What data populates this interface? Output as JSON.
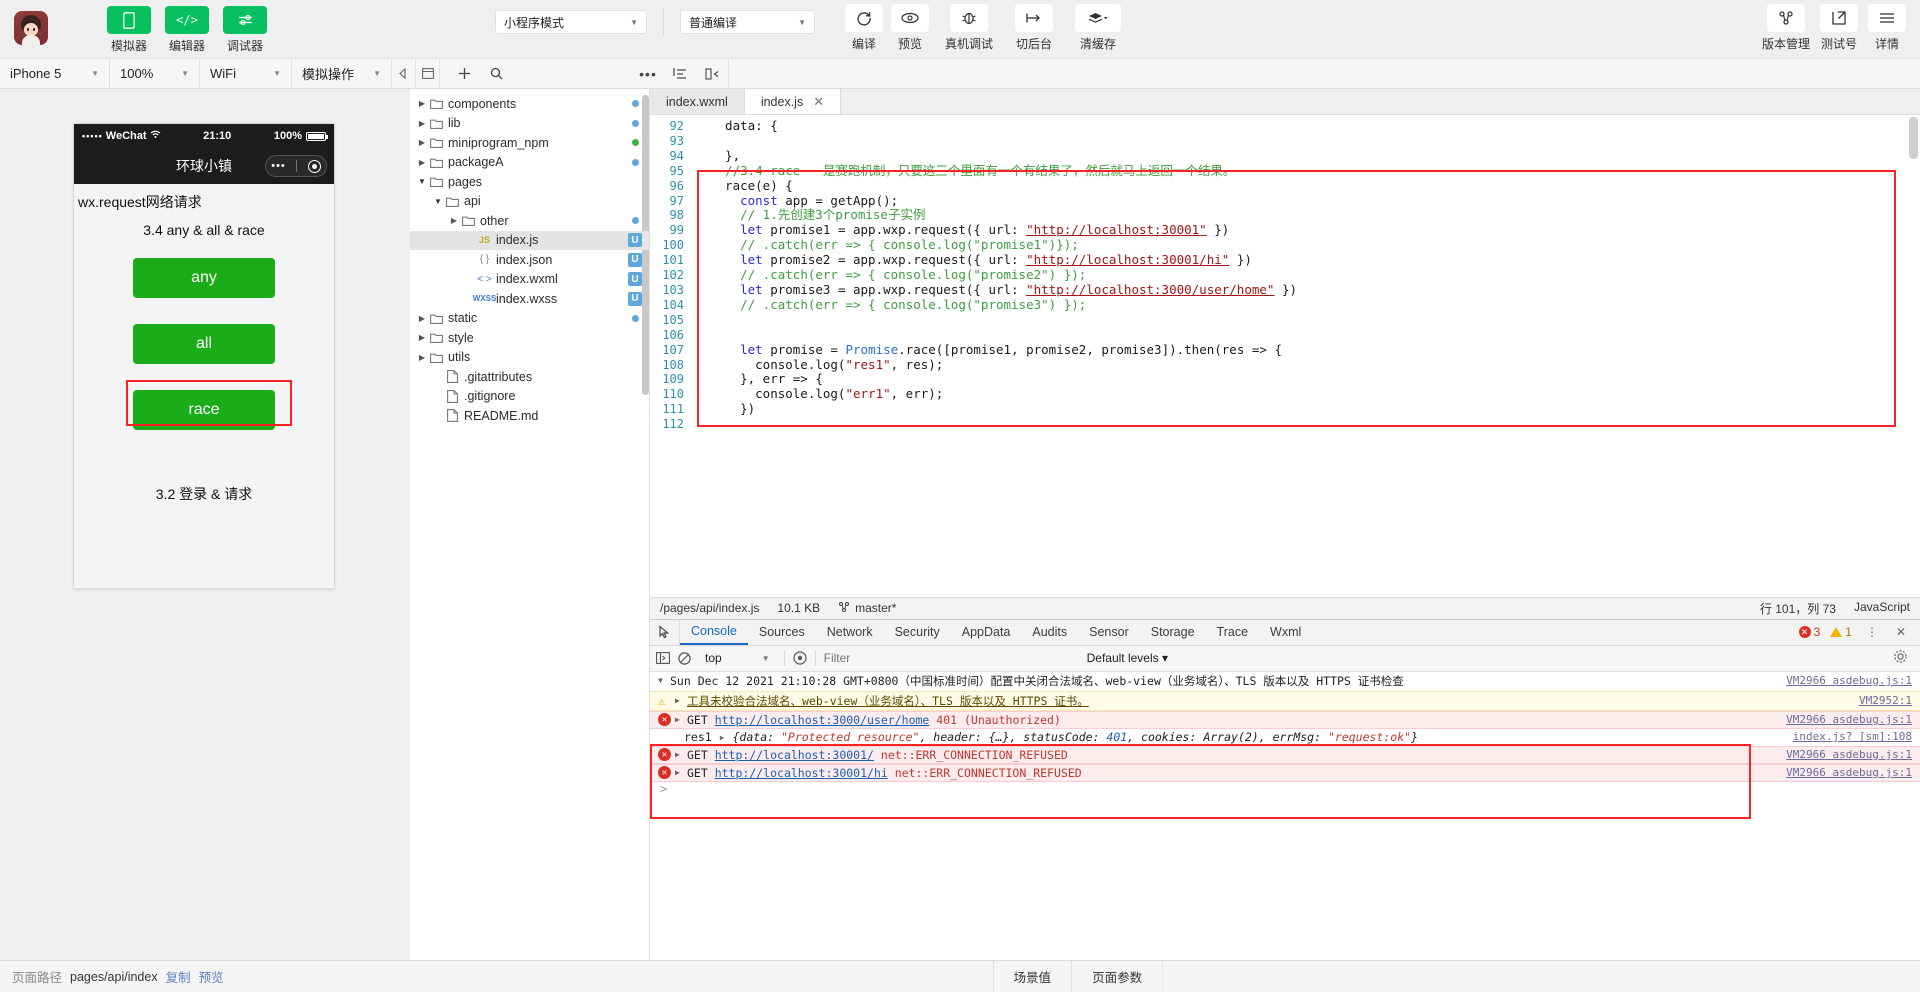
{
  "toolbar": {
    "avatar_name": "user-avatar",
    "left_buttons": [
      {
        "label": "模拟器",
        "icon": "phone-icon"
      },
      {
        "label": "编辑器",
        "icon": "code-icon"
      },
      {
        "label": "调试器",
        "icon": "sliders-icon"
      }
    ],
    "mode_select": "小程序模式",
    "compile_select": "普通编译",
    "action_buttons": [
      {
        "label": "编译",
        "icon": "refresh-icon"
      },
      {
        "label": "预览",
        "icon": "eye-icon"
      },
      {
        "label": "真机调试",
        "icon": "bug-icon"
      },
      {
        "label": "切后台",
        "icon": "background-icon"
      },
      {
        "label": "清缓存",
        "icon": "layers-icon"
      }
    ],
    "right_buttons": [
      {
        "label": "版本管理",
        "icon": "branch-icon"
      },
      {
        "label": "测试号",
        "icon": "external-link-icon"
      },
      {
        "label": "详情",
        "icon": "hamburger-icon"
      }
    ]
  },
  "subbar": {
    "device": "iPhone 5",
    "zoom": "100%",
    "network": "WiFi",
    "sim_action": "模拟操作"
  },
  "simulator": {
    "status": {
      "carrier": "WeChat",
      "signal_dots": "•••••",
      "time": "21:10",
      "battery": "100%"
    },
    "nav_title": "环球小镇",
    "page_title": "wx.request网络请求",
    "section_title": "3.4 any & all & race",
    "buttons": [
      "any",
      "all",
      "race"
    ],
    "footer_title": "3.2 登录 & 请求",
    "highlighted_button": "race"
  },
  "files": [
    {
      "name": "components",
      "type": "folder",
      "indent": 0,
      "open": false,
      "dot": "#5fa8dd"
    },
    {
      "name": "lib",
      "type": "folder",
      "indent": 0,
      "open": false,
      "dot": "#5fa8dd"
    },
    {
      "name": "miniprogram_npm",
      "type": "folder",
      "indent": 0,
      "open": false,
      "dot": "#3ab54a"
    },
    {
      "name": "packageA",
      "type": "folder",
      "indent": 0,
      "open": false,
      "dot": "#5fa8dd"
    },
    {
      "name": "pages",
      "type": "folder",
      "indent": 0,
      "open": true,
      "dot": ""
    },
    {
      "name": "api",
      "type": "folder",
      "indent": 1,
      "open": true,
      "dot": ""
    },
    {
      "name": "other",
      "type": "folder",
      "indent": 2,
      "open": false,
      "dot": "#5fa8dd"
    },
    {
      "name": "index.js",
      "type": "js",
      "indent": 3,
      "selected": true,
      "badge": "U"
    },
    {
      "name": "index.json",
      "type": "json",
      "indent": 3,
      "badge": "U"
    },
    {
      "name": "index.wxml",
      "type": "wxml",
      "indent": 3,
      "badge": "U"
    },
    {
      "name": "index.wxss",
      "type": "wxss",
      "indent": 3,
      "badge": "U"
    },
    {
      "name": "static",
      "type": "folder",
      "indent": 0,
      "open": false,
      "dot": "#5fa8dd"
    },
    {
      "name": "style",
      "type": "folder",
      "indent": 0,
      "open": false,
      "dot": ""
    },
    {
      "name": "utils",
      "type": "folder",
      "indent": 0,
      "open": false,
      "dot": ""
    },
    {
      "name": ".gitattributes",
      "type": "file",
      "indent": 1,
      "dot": ""
    },
    {
      "name": ".gitignore",
      "type": "file",
      "indent": 1,
      "dot": ""
    },
    {
      "name": "README.md",
      "type": "file",
      "indent": 1,
      "dot": ""
    }
  ],
  "editor": {
    "tabs": [
      {
        "label": "index.wxml",
        "active": false,
        "closable": false
      },
      {
        "label": "index.js",
        "active": true,
        "closable": true
      }
    ],
    "first_line_no": 92,
    "lines": [
      {
        "n": 92,
        "html": "  data: {"
      },
      {
        "n": 93,
        "html": ""
      },
      {
        "n": 94,
        "html": "  },"
      },
      {
        "n": 95,
        "html": "  <span class='cm'>//3.4 race   是赛跑机制，只要这三个里面有一个有结果了，然后就马上返回一个结果。</span>"
      },
      {
        "n": 96,
        "html": "  race(e) {"
      },
      {
        "n": 97,
        "html": "    <span class='kw'>const</span> app = getApp();"
      },
      {
        "n": 98,
        "html": "    <span class='cm'>// 1.先创建3个promise子实例</span>"
      },
      {
        "n": 99,
        "html": "    <span class='kw'>let</span> promise1 = app.wxp.request({ url: <span class='lnk'>\"http://localhost:30001\"</span> })"
      },
      {
        "n": 100,
        "html": "    <span class='cm'>// .catch(err =&gt; { console.log(\"promise1\")});</span>"
      },
      {
        "n": 101,
        "html": "    <span class='kw'>let</span> promise2 = app.wxp.request({ url: <span class='lnk'>\"http://localhost:30001/hi\"</span> })"
      },
      {
        "n": 102,
        "html": "    <span class='cm'>// .catch(err =&gt; { console.log(\"promise2\") });</span>"
      },
      {
        "n": 103,
        "html": "    <span class='kw'>let</span> promise3 = app.wxp.request({ url: <span class='lnk'>\"http://localhost:3000/user/home\"</span> })"
      },
      {
        "n": 104,
        "html": "    <span class='cm'>// .catch(err =&gt; { console.log(\"promise3\") });</span>"
      },
      {
        "n": 105,
        "html": ""
      },
      {
        "n": 106,
        "html": ""
      },
      {
        "n": 107,
        "html": "    <span class='kw'>let</span> promise = <span class='cls'>Promise</span>.race([promise1, promise2, promise3]).then(res =&gt; {"
      },
      {
        "n": 108,
        "html": "      console.log(<span class='str'>\"res1\"</span>, res);"
      },
      {
        "n": 109,
        "html": "    }, err =&gt; {"
      },
      {
        "n": 110,
        "html": "      console.log(<span class='str'>\"err1\"</span>, err);"
      },
      {
        "n": 111,
        "html": "    })"
      },
      {
        "n": 112,
        "html": ""
      }
    ],
    "status": {
      "path": "/pages/api/index.js",
      "size": "10.1 KB",
      "branch": "master*",
      "cursor": "行 101，列 73",
      "language": "JavaScript"
    }
  },
  "devtools": {
    "tabs": [
      "Console",
      "Sources",
      "Network",
      "Security",
      "AppData",
      "Audits",
      "Sensor",
      "Storage",
      "Trace",
      "Wxml"
    ],
    "active_tab": "Console",
    "error_count": "3",
    "warn_count": "1",
    "filter_bar": {
      "context": "top",
      "filter_placeholder": "Filter",
      "levels": "Default levels"
    },
    "messages": [
      {
        "kind": "info",
        "text": "Sun Dec 12 2021 21:10:28 GMT+0800（中国标准时间）配置中关闭合法域名、web-view（业务域名）、TLS 版本以及 HTTPS 证书检查",
        "source": "VM2966 asdebug.js:1"
      },
      {
        "kind": "warn",
        "text": "工具未校验合法域名、web-view（业务域名）、TLS 版本以及 HTTPS 证书。",
        "source": "VM2952:1"
      },
      {
        "kind": "err",
        "text": "GET http://localhost:3000/user/home 401 (Unauthorized)",
        "url": "http://localhost:3000/user/home",
        "suffix": "401 (Unauthorized)",
        "source": "VM2966 asdebug.js:1"
      },
      {
        "kind": "plain",
        "text": "res1 {data: \"Protected resource\", header: {…}, statusCode: 401, cookies: Array(2), errMsg: \"request:ok\"}",
        "source": "index.js? [sm]:108"
      },
      {
        "kind": "err",
        "text": "GET http://localhost:30001/ net::ERR_CONNECTION_REFUSED",
        "url": "http://localhost:30001/",
        "suffix": "net::ERR_CONNECTION_REFUSED",
        "source": "VM2966 asdebug.js:1"
      },
      {
        "kind": "err",
        "text": "GET http://localhost:30001/hi net::ERR_CONNECTION_REFUSED",
        "url": "http://localhost:30001/hi",
        "suffix": "net::ERR_CONNECTION_REFUSED",
        "source": "VM2966 asdebug.js:1"
      }
    ],
    "prompt": ">"
  },
  "bottom": {
    "path_label": "页面路径",
    "path_value": "pages/api/index",
    "copy_label": "复制",
    "preview_label": "预览",
    "scene_tab": "场景值",
    "params_tab": "页面参数"
  },
  "colors": {
    "accent_green": "#07c160",
    "button_green": "#1aad19",
    "highlight_red": "#ff2222",
    "error_red": "#d93025",
    "link_blue": "#1769c4"
  }
}
